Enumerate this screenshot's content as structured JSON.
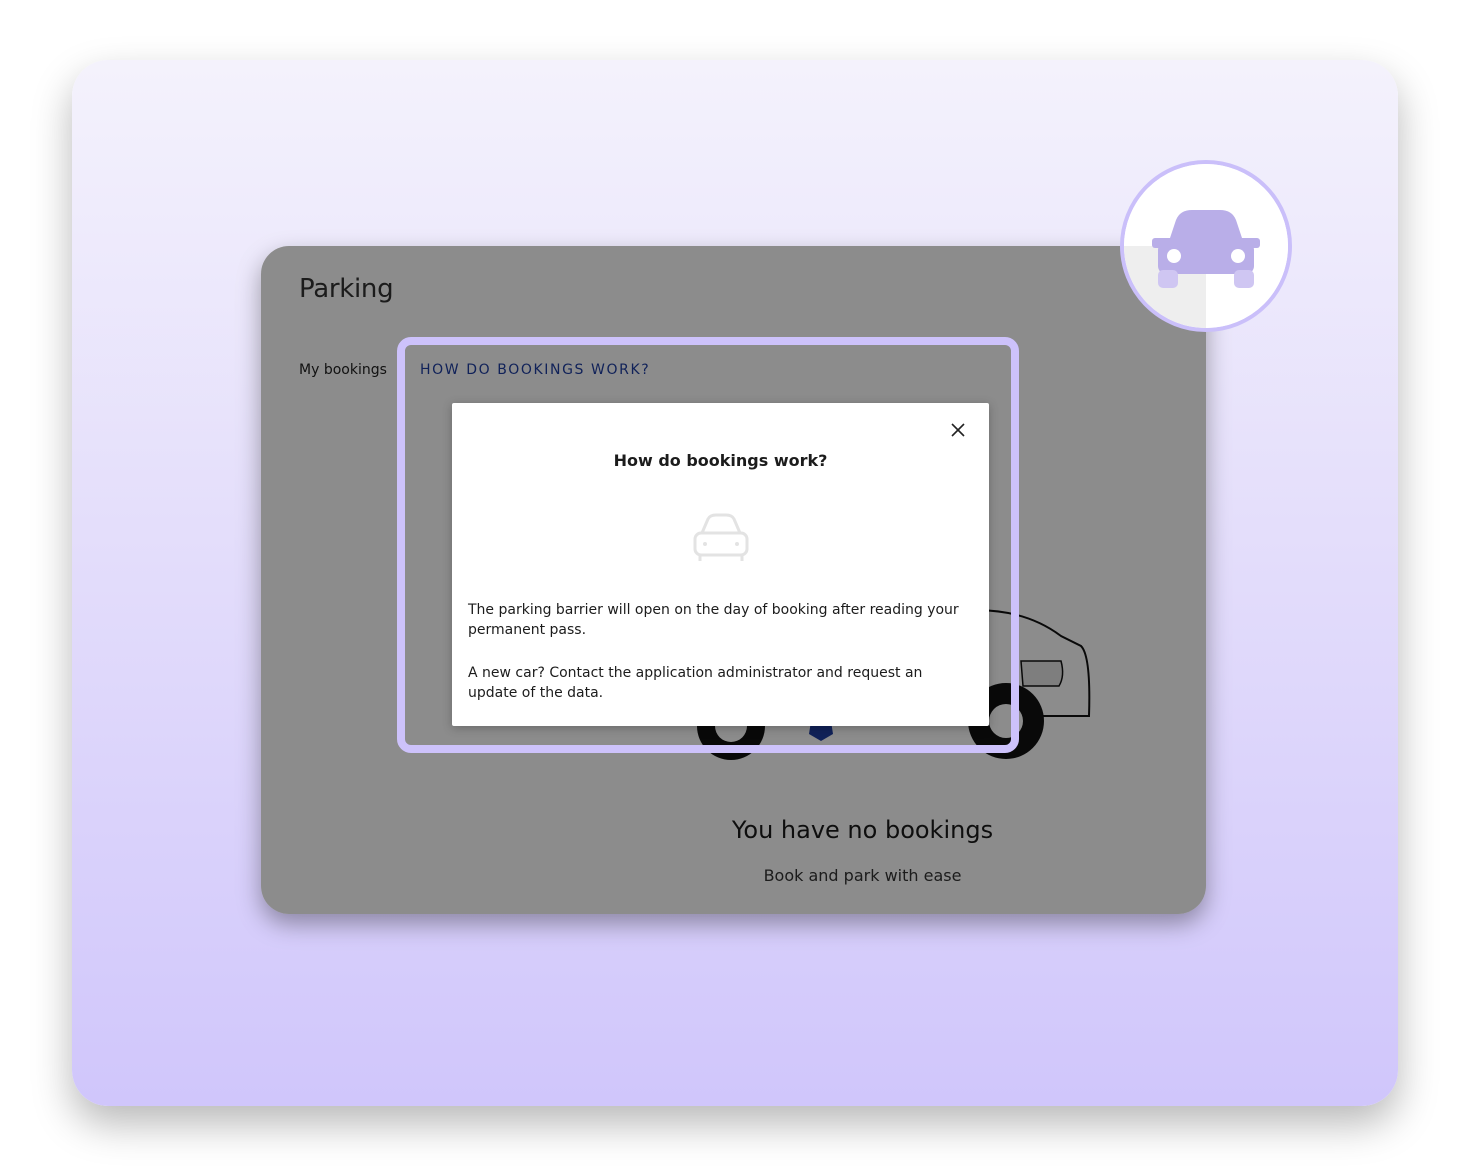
{
  "app": {
    "title": "Parking"
  },
  "tabs": {
    "my_bookings": "My bookings",
    "how_do_bookings_work": "HOW DO BOOKINGS WORK?"
  },
  "empty_state": {
    "title": "You have no bookings",
    "subtitle": "Book and park with ease"
  },
  "modal": {
    "title": "How do bookings work?",
    "close_icon": "close-icon",
    "paragraph_1": "The parking barrier will open on the day of booking after reading your permanent pass.",
    "paragraph_2": "A new car? Contact the application administrator and request an update of the data."
  },
  "badge": {
    "icon": "car-icon"
  },
  "colors": {
    "accent": "#1f3fa3",
    "highlight": "#cdc2fb",
    "badge_car": "#b9aee8"
  }
}
